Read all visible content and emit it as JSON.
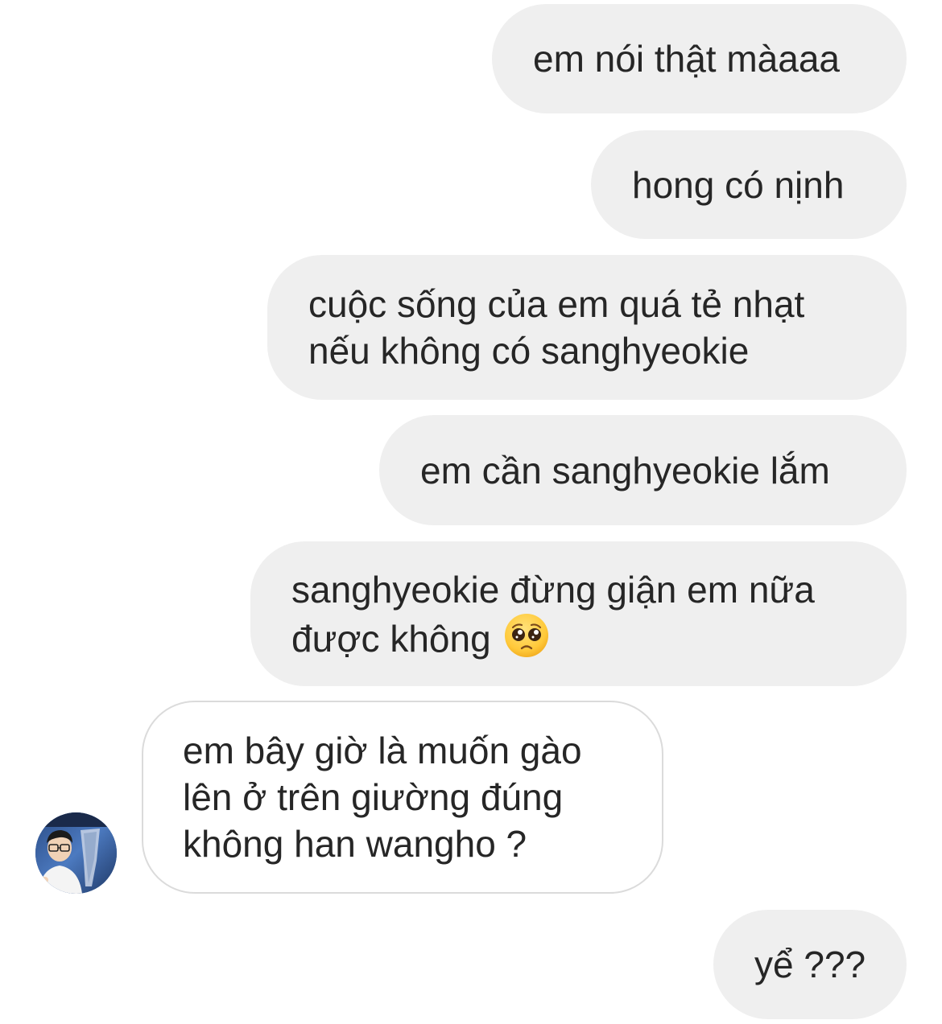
{
  "conversation": {
    "messages": [
      {
        "id": "m1",
        "direction": "sent",
        "text": "em nói thật màaaa"
      },
      {
        "id": "m2",
        "direction": "sent",
        "text": "hong có nịnh"
      },
      {
        "id": "m3",
        "direction": "sent",
        "text": "cuộc sống của em quá tẻ nhạt\nnếu không có sanghyeokie"
      },
      {
        "id": "m4",
        "direction": "sent",
        "text": "em cần sanghyeokie lắm"
      },
      {
        "id": "m5",
        "direction": "sent",
        "text": "sanghyeokie đừng giận em nữa\nđược không",
        "emoji": "pleading-face-emoji"
      },
      {
        "id": "m6",
        "direction": "received",
        "text": "em bây giờ là muốn gào\nlên ở trên giường đúng\nkhông han wangho ?"
      },
      {
        "id": "m7",
        "direction": "sent",
        "text": "yể ???"
      }
    ]
  },
  "colors": {
    "sent_bubble": "#efefef",
    "received_border": "#dbdbdb",
    "text": "#262626",
    "background": "#ffffff"
  }
}
